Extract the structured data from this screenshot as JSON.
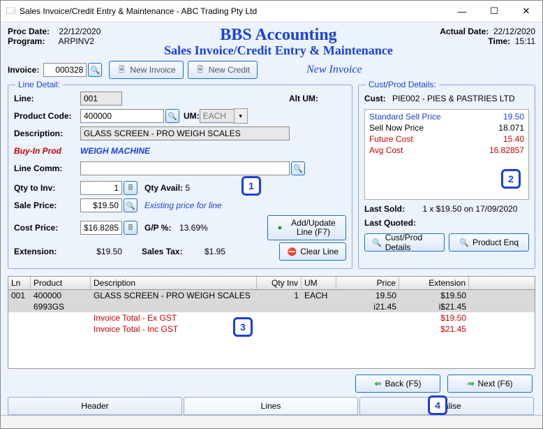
{
  "window": {
    "title": "Sales Invoice/Credit Entry & Maintenance - ABC Trading Pty Ltd"
  },
  "header": {
    "proc_date_label": "Proc Date:",
    "proc_date": "22/12/2020",
    "program_label": "Program:",
    "program": "ARPINV2",
    "brand": "BBS Accounting",
    "subtitle": "Sales Invoice/Credit Entry & Maintenance",
    "actual_date_label": "Actual Date:",
    "actual_date": "22/12/2020",
    "time_label": "Time:",
    "time": "15:11"
  },
  "toolbar": {
    "invoice_label": "Invoice:",
    "invoice_no": "000328",
    "new_invoice": "New Invoice",
    "new_credit": "New Credit",
    "mode": "New Invoice"
  },
  "line": {
    "legend": "Line Detail:",
    "line_label": "Line:",
    "line_no": "001",
    "alt_um_label": "Alt UM:",
    "product_code_label": "Product Code:",
    "product_code": "400000",
    "um_label": "UM:",
    "um": "EACH",
    "description_label": "Description:",
    "description": "GLASS SCREEN - PRO WEIGH SCALES",
    "buyin_label": "Buy-In Prod",
    "buyin_value": "WEIGH MACHINE",
    "line_comm_label": "Line Comm:",
    "line_comm": "",
    "qty_label": "Qty to Inv:",
    "qty": "1",
    "qty_avail_label": "Qty Avail:",
    "qty_avail": "5",
    "sale_price_label": "Sale Price:",
    "sale_price": "$19.50",
    "existing_price": "Existing price for line",
    "cost_price_label": "Cost Price:",
    "cost_price": "$16.8285",
    "gp_label": "G/P %:",
    "gp": "13.69%",
    "extension_label": "Extension:",
    "extension": "$19.50",
    "sales_tax_label": "Sales Tax:",
    "sales_tax": "$1.95",
    "add_update": "Add/Update Line (F7)",
    "clear_line": "Clear Line"
  },
  "cust": {
    "legend": "Cust/Prod Details:",
    "cust_label": "Cust:",
    "cust_value": "PIE002 - PIES & PASTRIES LTD",
    "rows": [
      {
        "k": "Standard Sell Price",
        "v": "19.50",
        "cls": "blue"
      },
      {
        "k": "Sell Now Price",
        "v": "18.071",
        "cls": ""
      },
      {
        "k": "Future Cost",
        "v": "15.40",
        "cls": "red"
      },
      {
        "k": "Avg Cost",
        "v": "16.82857",
        "cls": "red"
      }
    ],
    "last_sold_label": "Last Sold:",
    "last_sold": "1 x $19.50 on 17/09/2020",
    "last_quoted_label": "Last Quoted:",
    "last_quoted": "",
    "cust_prod_btn": "Cust/Prod Details",
    "product_enq_btn": "Product Enq"
  },
  "grid": {
    "headers": {
      "ln": "Ln",
      "product": "Product",
      "description": "Description",
      "qty": "Qty Inv",
      "um": "UM",
      "price": "Price",
      "ext": "Extension"
    },
    "rows": [
      {
        "ln": "001",
        "product": "400000",
        "desc": "GLASS SCREEN - PRO WEIGH SCALES",
        "qty": "1",
        "um": "EACH",
        "price": "19.50",
        "ext": "$19.50",
        "sel": true
      },
      {
        "ln": "",
        "product": "6993GS",
        "desc": "",
        "qty": "",
        "um": "",
        "price": "i21.45",
        "ext": "i$21.45",
        "sel": true
      },
      {
        "ln": "",
        "product": "",
        "desc": "Invoice Total - Ex GST",
        "qty": "",
        "um": "",
        "price": "",
        "ext": "$19.50",
        "red": true
      },
      {
        "ln": "",
        "product": "",
        "desc": "Invoice Total - Inc GST",
        "qty": "",
        "um": "",
        "price": "",
        "ext": "$21.45",
        "red": true
      }
    ]
  },
  "footer": {
    "back": "Back (F5)",
    "next": "Next (F6)"
  },
  "tabs": {
    "header": "Header",
    "lines": "Lines",
    "finalise": "Finalise"
  },
  "markers": {
    "m1": "1",
    "m2": "2",
    "m3": "3",
    "m4": "4"
  }
}
